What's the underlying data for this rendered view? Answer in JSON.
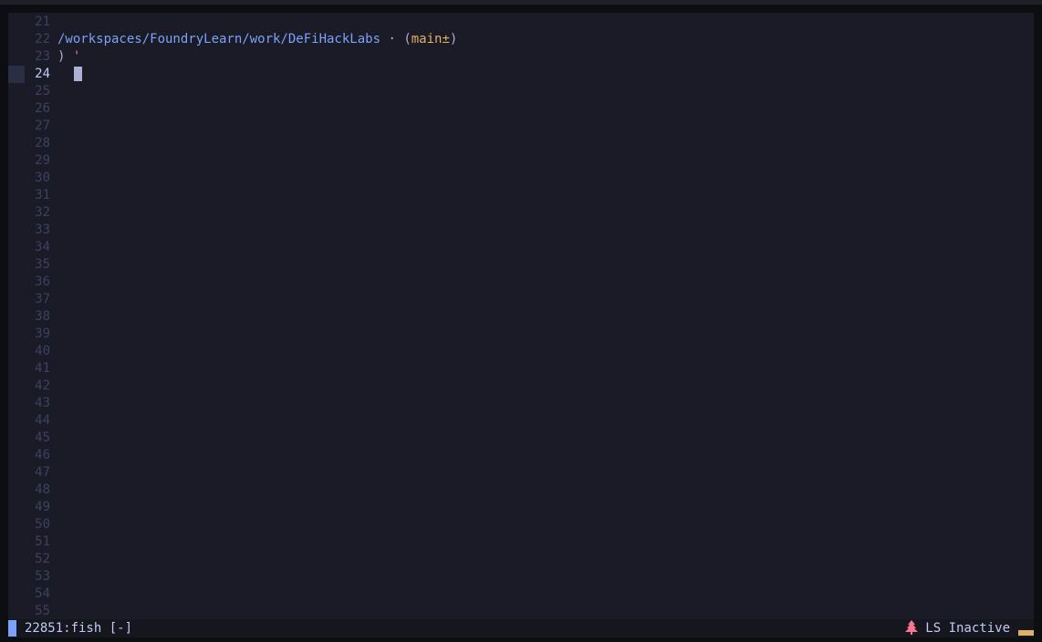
{
  "editor": {
    "line_numbers": [
      "21",
      "22",
      "23",
      "24",
      "25",
      "26",
      "27",
      "28",
      "29",
      "30",
      "31",
      "32",
      "33",
      "34",
      "35",
      "36",
      "37",
      "38",
      "39",
      "40",
      "41",
      "42",
      "43",
      "44",
      "45",
      "46",
      "47",
      "48",
      "49",
      "50",
      "51",
      "52",
      "53",
      "54",
      "55"
    ],
    "current_line": "24",
    "prompt_path": "/workspaces/FoundryLearn/work/DeFiHackLabs",
    "prompt_separator": " · ",
    "git_open": "(",
    "git_branch": "main±",
    "git_close": ")",
    "prompt_symbol": ")",
    "typed_text": "'"
  },
  "statusbar": {
    "terminal_label": "22851:fish [-]",
    "ls_status": "LS Inactive",
    "icon": "tree-icon"
  },
  "colors": {
    "background": "#1a1b26",
    "path": "#7aa2f7",
    "branch": "#e0af68",
    "quote": "#f7768e",
    "line_number": "#3b4261",
    "status_bg": "#16161e"
  }
}
